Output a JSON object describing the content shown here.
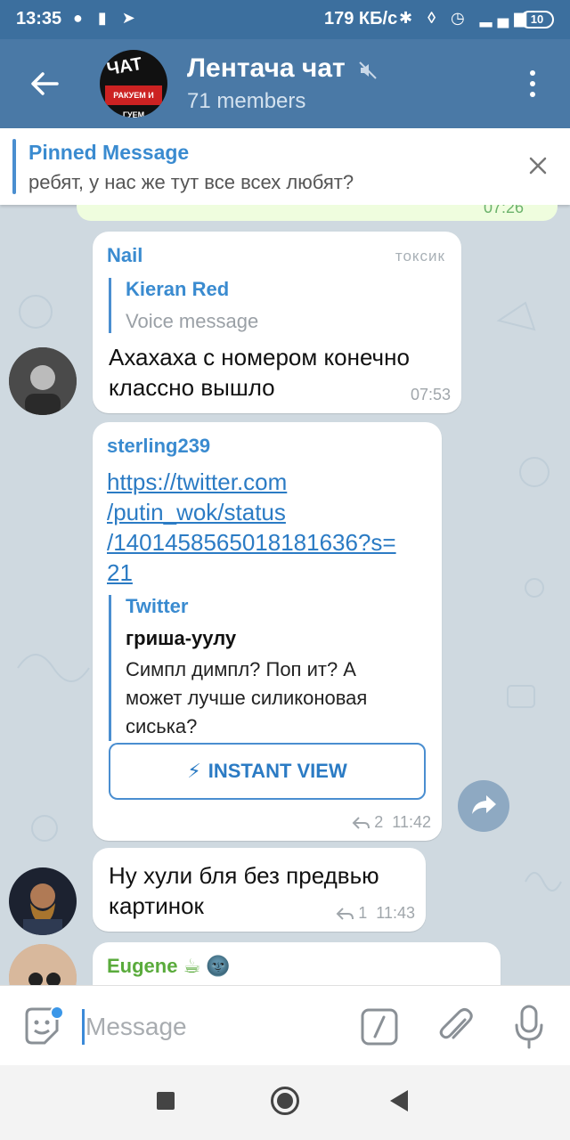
{
  "status_bar": {
    "time": "13:35",
    "network_speed": "179 КБ/с",
    "battery": "10"
  },
  "header": {
    "title": "Лентача чат",
    "subtitle": "71 members",
    "avatar_text_top": "ЧАТ",
    "avatar_text_bottom": "РАКУЕМ И ГУЕМ"
  },
  "pinned": {
    "title": "Pinned Message",
    "text": "ребят, у нас же тут все всех любят?"
  },
  "prev_message": {
    "time": "07:26"
  },
  "messages": [
    {
      "author": "Nail",
      "tag": "токсик",
      "reply_author": "Kieran Red",
      "reply_text": "Voice message",
      "text_line1": "Ахахаха с номером конечно",
      "text_line2": "классно вышло",
      "time": "07:53"
    },
    {
      "author": "sterling239",
      "link_line1": "https://twitter.com",
      "link_line2": "/putin_wok/status",
      "link_line3": "/1401458565018181636?s=",
      "link_line4": "21",
      "preview_site": "Twitter",
      "preview_author": "гриша-уулу",
      "preview_line1": "Симпл димпл? Поп ит? А",
      "preview_line2": "может лучше силиконовая",
      "preview_line3": "сиська?",
      "instant_view": "INSTANT VIEW",
      "replies": "2",
      "time": "11:42"
    },
    {
      "text_line1": "Ну хули бля без предвью",
      "text_line2": "картинок",
      "replies": "1",
      "time": "11:43"
    },
    {
      "author": "Eugene ☕ 🌚"
    }
  ],
  "input": {
    "placeholder": "Message"
  },
  "colors": {
    "header": "#4a79a6",
    "accent": "#3a8bd0",
    "eugene_name": "#5aab3c",
    "chat_bg": "#cfd9e0"
  }
}
